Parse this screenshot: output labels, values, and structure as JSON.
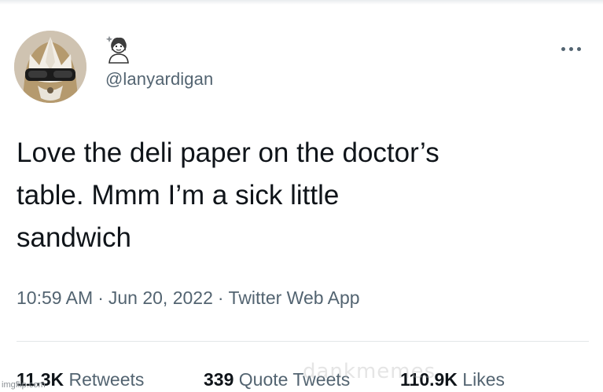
{
  "tweet": {
    "handle": "@lanyardigan",
    "text": "Love the deli paper on the doctor’s\ntable. Mmm I’m a sick little\nsandwich",
    "time": "10:59 AM",
    "date": "Jun 20, 2022",
    "source": "Twitter Web App",
    "separator": "·"
  },
  "stats": {
    "retweets_count": "11.3K",
    "retweets_label": "Retweets",
    "quotes_count": "339",
    "quotes_label": "Quote Tweets",
    "likes_count": "110.9K",
    "likes_label": "Likes"
  },
  "icons": {
    "more": "more-horizontal-icon",
    "display_name_emoji": "woman-emoji-icon"
  },
  "watermarks": {
    "left": "imgflip.com",
    "center": "dankmemes"
  }
}
